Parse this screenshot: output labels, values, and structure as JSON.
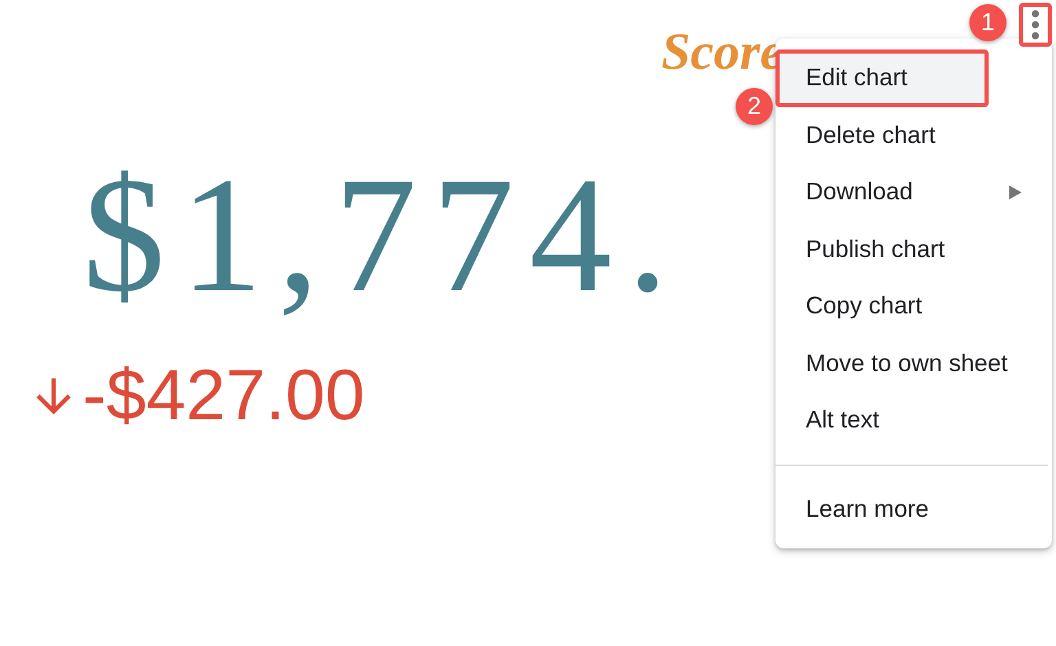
{
  "scorecard": {
    "title": "Score",
    "value": "$1,774.",
    "change": {
      "down": true,
      "text": "-$427.00"
    }
  },
  "menu_button": {
    "outlined": true,
    "badge": "1"
  },
  "menu": {
    "items": [
      {
        "kind": "item",
        "label": "Edit chart",
        "selected": true,
        "outlined": true,
        "badge": "2"
      },
      {
        "kind": "item",
        "label": "Delete chart",
        "selected": false,
        "outlined": false
      },
      {
        "kind": "submenu",
        "label": "Download",
        "selected": false,
        "outlined": false
      },
      {
        "kind": "item",
        "label": "Publish chart",
        "selected": false,
        "outlined": false
      },
      {
        "kind": "item",
        "label": "Copy chart",
        "selected": false,
        "outlined": false
      },
      {
        "kind": "item",
        "label": "Move to own sheet",
        "selected": false,
        "outlined": false
      },
      {
        "kind": "item",
        "label": "Alt text",
        "selected": false,
        "outlined": false
      },
      {
        "kind": "divider"
      },
      {
        "kind": "item",
        "label": "Learn more",
        "selected": false,
        "outlined": false
      }
    ]
  }
}
